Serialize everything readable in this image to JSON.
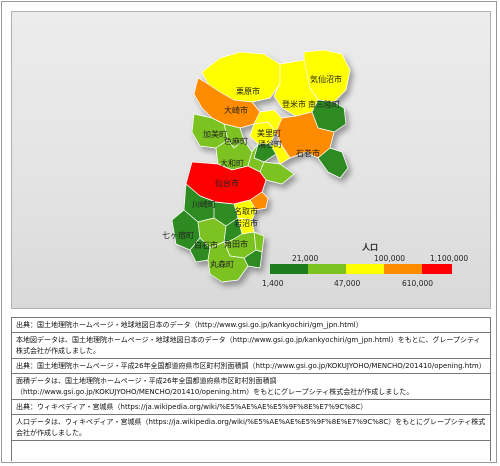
{
  "map": {
    "regions": [
      {
        "id": "kesennuma",
        "name": "気仙沼市",
        "color": "#ffff00"
      },
      {
        "id": "kurihara",
        "name": "栗原市",
        "color": "#ffff00"
      },
      {
        "id": "tome",
        "name": "登米市",
        "color": "#ffff00"
      },
      {
        "id": "minamisanriku",
        "name": "南三陸町",
        "color": "#2e8b22"
      },
      {
        "id": "osaki",
        "name": "大崎市",
        "color": "#ff8c00"
      },
      {
        "id": "kami",
        "name": "加美町",
        "color": "#7cc321"
      },
      {
        "id": "shikama",
        "name": "色麻町",
        "color": "#7cc321"
      },
      {
        "id": "misato",
        "name": "美里町",
        "color": "#ffff00"
      },
      {
        "id": "wakuya",
        "name": "涌谷町",
        "color": "#ffff00"
      },
      {
        "id": "ishinomaki",
        "name": "石巻市",
        "color": "#ff8c00"
      },
      {
        "id": "taiwa",
        "name": "大和町",
        "color": "#7cc321"
      },
      {
        "id": "sendai",
        "name": "仙台市",
        "color": "#ff0000"
      },
      {
        "id": "kawasaki",
        "name": "川崎町",
        "color": "#2e8b22"
      },
      {
        "id": "natori",
        "name": "名取市",
        "color": "#ffff00"
      },
      {
        "id": "iwanuma",
        "name": "岩沼市",
        "color": "#ffff00"
      },
      {
        "id": "shichikashuku",
        "name": "七ヶ宿町",
        "color": "#2e8b22"
      },
      {
        "id": "shiroishi",
        "name": "白石市",
        "color": "#7cc321"
      },
      {
        "id": "kakuda",
        "name": "角田市",
        "color": "#7cc321"
      },
      {
        "id": "marumori",
        "name": "丸森町",
        "color": "#7cc321"
      }
    ]
  },
  "legend": {
    "title": "人口",
    "colors": [
      "#1e7b1e",
      "#7cc321",
      "#ffff00",
      "#ff8c00",
      "#ff0000"
    ],
    "top_ticks": [
      "21,000",
      "100,000",
      "1,100,000"
    ],
    "bottom_ticks": [
      "1,400",
      "47,000",
      "610,000"
    ]
  },
  "sources": [
    "出典：国土地理院ホームページ・地球地図日本のデータ（http://www.gsi.go.jp/kankyochiri/gm_jpn.html）",
    "本地図データは、国土地理院ホームページ・地球地図日本のデータ（http://www.gsi.go.jp/kankyochiri/gm_jpn.html）をもとに、グレープシティ株式会社が作成しました。",
    "出典：国土地理院ホームページ・平成26年全国都道府県市区町村別面積調（http://www.gsi.go.jp/KOKUJYOHO/MENCHO/201410/opening.htm）",
    "面積データは、国土地理院ホームページ・平成26年全国都道府県市区町村別面積調（http://www.gsi.go.jp/KOKUJYOHO/MENCHO/201410/opening.htm）をもとにグレープシティ株式会社が作成しました。",
    "出典：ウィキペディア・宮城県（https://ja.wikipedia.org/wiki/%E5%AE%AE%E5%9F%8E%E7%9C%8C）",
    "人口データは、ウィキペディア・宮城県（https://ja.wikipedia.org/wiki/%E5%AE%AE%E5%9F%8E%E7%9C%8C）をもとにグレープシティ株式会社が作成しました。"
  ]
}
